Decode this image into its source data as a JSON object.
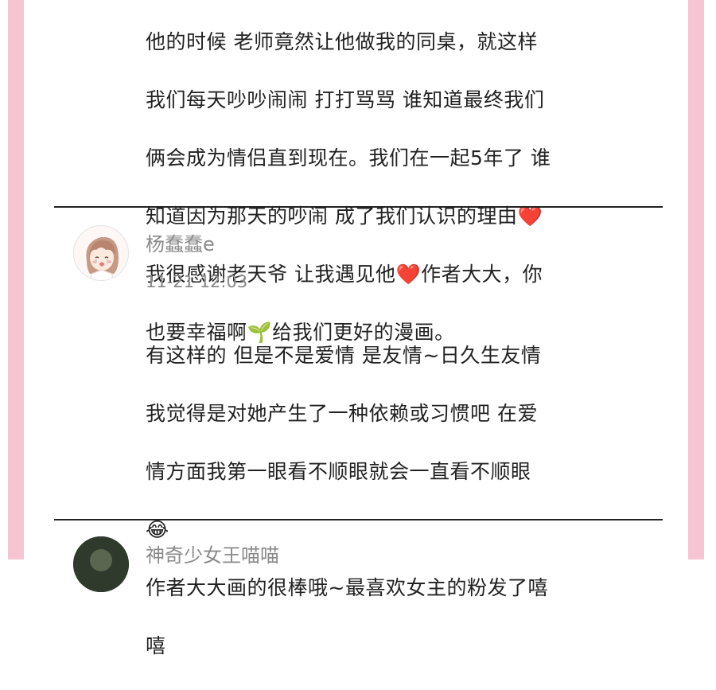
{
  "comments": [
    {
      "lines": [
        "他的时候 老师竟然让他做我的同桌，就这样",
        "我们每天吵吵闹闹 打打骂骂 谁知道最终我们",
        "俩会成为情侣直到现在。我们在一起5年了 谁",
        "知道因为那天的吵闹 成了我们认识的理由❤️",
        "我很感谢老天爷 让我遇见他❤️作者大大，你",
        "也要幸福啊🌱给我们更好的漫画。"
      ]
    },
    {
      "username": "杨蠢蠢e",
      "timestamp": "11-21 12:03",
      "avatar_icon": "anime-girl-avatar",
      "lines": [
        "有这样的 但是不是爱情 是友情~日久生友情",
        "我觉得是对她产生了一种依赖或习惯吧 在爱",
        "情方面我第一眼看不顺眼就会一直看不顺眼",
        "😂",
        "作者大大画的很棒哦~最喜欢女主的粉发了嘻",
        "嘻"
      ]
    },
    {
      "username": "神奇少女王喵喵",
      "avatar_icon": "photo-avatar"
    }
  ],
  "colors": {
    "border_pink": "#f6c4d3",
    "text": "#222222",
    "meta_gray": "#8a8a8a"
  }
}
